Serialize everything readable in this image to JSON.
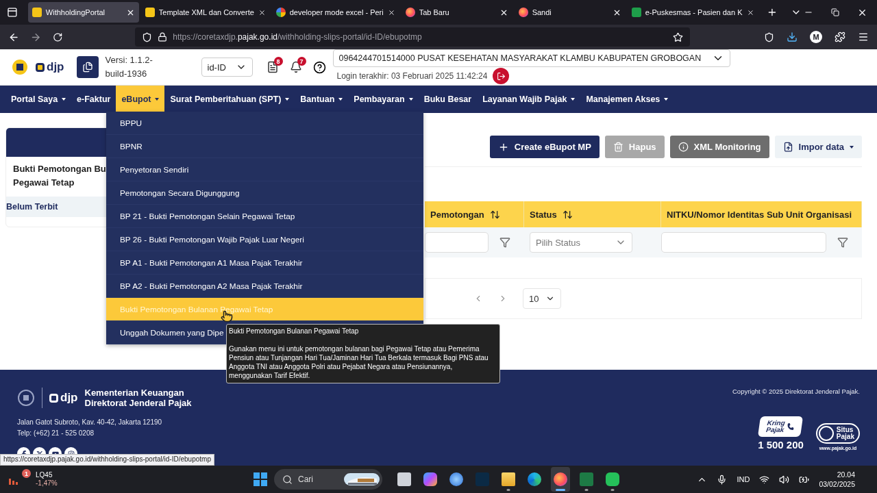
{
  "browser": {
    "tabs": [
      {
        "title": "WithholdingPortal",
        "kind": "djp",
        "selected": true
      },
      {
        "title": "Template XML dan Converte",
        "kind": "djp",
        "selected": false
      },
      {
        "title": "developer mode excel - Peri",
        "kind": "google",
        "selected": false
      },
      {
        "title": "Tab Baru",
        "kind": "firefox",
        "selected": false
      },
      {
        "title": "Sandi",
        "kind": "firefox",
        "selected": false
      },
      {
        "title": "e-Puskesmas - Pasien dan K",
        "kind": "sheet",
        "selected": false
      }
    ],
    "url": {
      "prefix": "https://coretaxdjp.",
      "domain": "pajak.go.id",
      "path": "/withholding-slips-portal/id-ID/ebupotmp"
    },
    "profile_initial": "M"
  },
  "header": {
    "logo_text": "djp",
    "version_lines": [
      "Versi:  1.1.2-",
      "build-1936"
    ],
    "language": "id-ID",
    "documents_badge": "8",
    "notifications_badge": "7",
    "taxpayer": "0964244701514000 PUSAT KESEHATAN MASYARAKAT KLAMBU KABUPATEN GROBOGAN",
    "last_login": "Login terakhir:  03 Februari 2025 11:42:24"
  },
  "nav": [
    {
      "label": "Portal Saya",
      "caret": true,
      "selected": false
    },
    {
      "label": "e-Faktur",
      "caret": false,
      "selected": false
    },
    {
      "label": "eBupot",
      "caret": true,
      "selected": true
    },
    {
      "label": "Surat Pemberitahuan (SPT)",
      "caret": true,
      "selected": false
    },
    {
      "label": "Bantuan",
      "caret": true,
      "selected": false
    },
    {
      "label": "Pembayaran",
      "caret": true,
      "selected": false
    },
    {
      "label": "Buku Besar",
      "caret": false,
      "selected": false
    },
    {
      "label": "Layanan Wajib Pajak",
      "caret": true,
      "selected": false
    },
    {
      "label": "Manajemen Akses",
      "caret": true,
      "selected": false
    }
  ],
  "dropdown": [
    {
      "label": "BPPU",
      "selected": false
    },
    {
      "label": "BPNR",
      "selected": false
    },
    {
      "label": "Penyetoran Sendiri",
      "selected": false
    },
    {
      "label": "Pemotongan Secara Digunggung",
      "selected": false
    },
    {
      "label": "BP 21 - Bukti Pemotongan Selain Pegawai Tetap",
      "selected": false
    },
    {
      "label": "BP 26 - Bukti Pemotongan Wajib Pajak Luar Negeri",
      "selected": false
    },
    {
      "label": "BP A1 - Bukti Pemotongan A1 Masa Pajak Terakhir",
      "selected": false
    },
    {
      "label": "BP A2 - Bukti Pemotongan A2 Masa Pajak Terakhir",
      "selected": false
    },
    {
      "label": "Bukti Pemotongan Bulanan Pegawai Tetap",
      "selected": true
    },
    {
      "label": "Unggah Dokumen yang Dipe",
      "selected": false
    }
  ],
  "tooltip": {
    "title": "Bukti Pemotongan Bulanan Pegawai Tetap",
    "body": "Gunakan menu ini untuk pemotongan bulanan bagi Pegawai Tetap atau Pemerima Pensiun atau Tunjangan Hari Tua/Jaminan Hari Tua Berkala termasuk Bagi PNS atau Anggota TNI atau Anggota Polri atau Pejabat Negara atau Pensiunannya, menggunakan Tarif Efektif."
  },
  "side_panel": {
    "title_lines": [
      "Bukti Pemotongan Bu",
      "Pegawai Tetap"
    ],
    "items": [
      {
        "label": "Belum Terbit",
        "selected": true
      }
    ]
  },
  "toolbar": [
    {
      "label": "Create eBupot MP",
      "kind": "create",
      "disabled": false
    },
    {
      "label": "Hapus",
      "kind": "delete",
      "disabled": true
    },
    {
      "label": "XML Monitoring",
      "kind": "monitor",
      "disabled": false
    },
    {
      "label": "Impor data",
      "kind": "import",
      "disabled": false
    }
  ],
  "table": {
    "columns": [
      {
        "label": "Pemotongan",
        "sortable": true
      },
      {
        "label": "Status",
        "sortable": true
      },
      {
        "label": "NITKU/Nomor Identitas Sub Unit Organisasi",
        "sortable": false
      }
    ],
    "filters": [
      {
        "kind": "text"
      },
      {
        "kind": "select",
        "placeholder": "Pilih Status"
      },
      {
        "kind": "text"
      }
    ]
  },
  "pagination": {
    "page_size": "10"
  },
  "footer": {
    "logo_text": "djp",
    "org_lines": [
      "Kementerian Keuangan",
      "Direktorat Jenderal Pajak"
    ],
    "address": "Jalan Gatot Subroto, Kav. 40-42, Jakarta 12190",
    "phone": "Telp: (+62) 21 - 525 0208",
    "copyright": "Copyright © 2025 Direktorat Jenderal Pajak.",
    "kring": {
      "line1": "Kring",
      "line2": "Pajak",
      "number": "1 500 200"
    },
    "situs": {
      "line1": "Situs",
      "line2": "Pajak",
      "url": "www.pajak.go.id"
    }
  },
  "status_url": "https://coretaxdjp.pajak.go.id/withholding-slips-portal/id-ID/ebupotmp",
  "taskbar": {
    "widget": {
      "badge": "1",
      "name": "LQ45",
      "change": "-1,47%"
    },
    "search_placeholder": "Cari",
    "apps": [
      {
        "kind": "taskview",
        "running": false,
        "selected": false
      },
      {
        "kind": "copilot",
        "running": false,
        "selected": false
      },
      {
        "kind": "globe",
        "running": false,
        "selected": false
      },
      {
        "kind": "photoshop",
        "running": false,
        "selected": false
      },
      {
        "kind": "explorer",
        "running": true,
        "selected": false
      },
      {
        "kind": "edge",
        "running": false,
        "selected": false
      },
      {
        "kind": "firefox",
        "running": true,
        "selected": true
      },
      {
        "kind": "excel",
        "running": true,
        "selected": false
      },
      {
        "kind": "whatsapp",
        "running": true,
        "selected": false
      }
    ],
    "language": "IND",
    "time": "20.04",
    "date": "03/02/2025"
  }
}
